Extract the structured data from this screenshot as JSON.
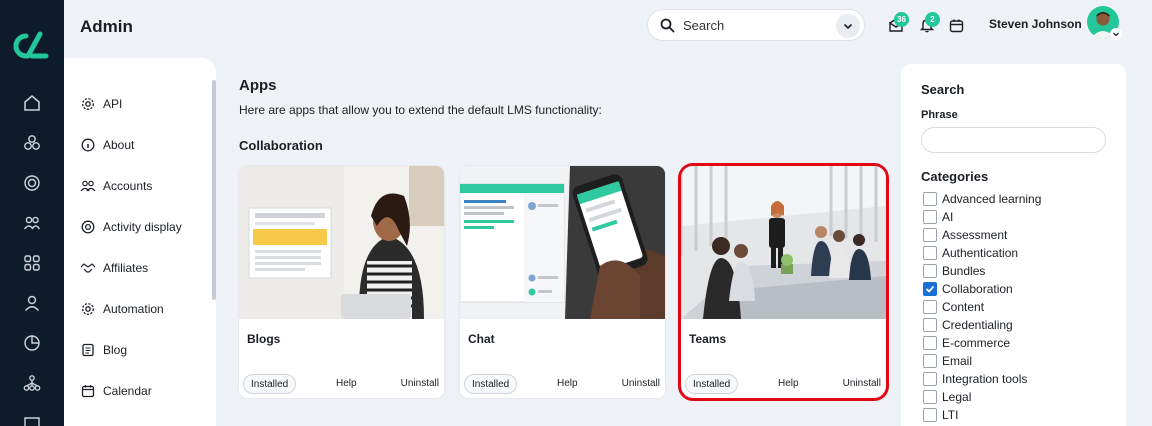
{
  "header": {
    "title": "Admin",
    "search_label": "Search",
    "inbox_count": "36",
    "notif_count": "2",
    "user_name": "Steven Johnson"
  },
  "subnav": {
    "items": [
      {
        "label": "API",
        "icon": "gear-icon"
      },
      {
        "label": "About",
        "icon": "info-icon"
      },
      {
        "label": "Accounts",
        "icon": "users-icon"
      },
      {
        "label": "Activity display",
        "icon": "target-icon"
      },
      {
        "label": "Affiliates",
        "icon": "handshake-icon"
      },
      {
        "label": "Automation",
        "icon": "gear-icon"
      },
      {
        "label": "Blog",
        "icon": "document-icon"
      },
      {
        "label": "Calendar",
        "icon": "calendar-icon"
      }
    ]
  },
  "main": {
    "title": "Apps",
    "description": "Here are apps that allow you to extend the default LMS functionality:",
    "section": "Collaboration",
    "cards": [
      {
        "name": "Blogs",
        "installed": "Installed",
        "help": "Help",
        "uninstall": "Uninstall"
      },
      {
        "name": "Chat",
        "installed": "Installed",
        "help": "Help",
        "uninstall": "Uninstall"
      },
      {
        "name": "Teams",
        "installed": "Installed",
        "help": "Help",
        "uninstall": "Uninstall"
      }
    ],
    "selected_card": "Teams"
  },
  "filter": {
    "title": "Search",
    "phrase_label": "Phrase",
    "phrase_value": "",
    "categories_label": "Categories",
    "categories": [
      {
        "label": "Advanced learning",
        "checked": false
      },
      {
        "label": "AI",
        "checked": false
      },
      {
        "label": "Assessment",
        "checked": false
      },
      {
        "label": "Authentication",
        "checked": false
      },
      {
        "label": "Bundles",
        "checked": false
      },
      {
        "label": "Collaboration",
        "checked": true
      },
      {
        "label": "Content",
        "checked": false
      },
      {
        "label": "Credentialing",
        "checked": false
      },
      {
        "label": "E-commerce",
        "checked": false
      },
      {
        "label": "Email",
        "checked": false
      },
      {
        "label": "Integration tools",
        "checked": false
      },
      {
        "label": "Legal",
        "checked": false
      },
      {
        "label": "LTI",
        "checked": false
      }
    ]
  },
  "colors": {
    "rail": "#0d1b2a",
    "accent": "#23c79a",
    "selection": "#e30613",
    "checkbox": "#1a6fd6"
  }
}
